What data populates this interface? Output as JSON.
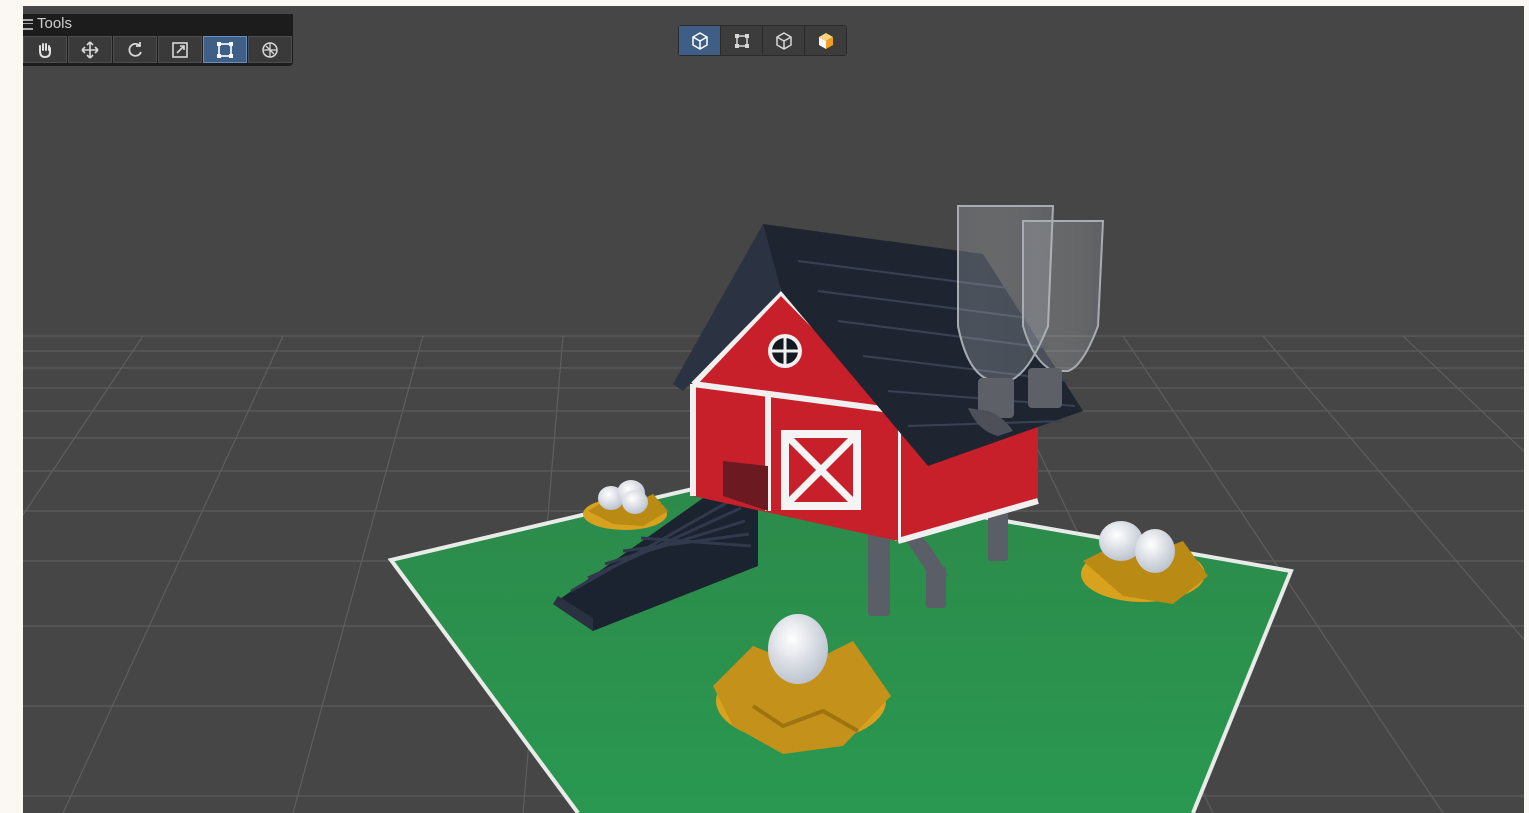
{
  "tools_panel": {
    "title": "Tools",
    "tools": [
      {
        "name": "hand-tool",
        "icon": "hand-icon",
        "active": false
      },
      {
        "name": "move-tool",
        "icon": "move-arrows-icon",
        "active": false
      },
      {
        "name": "rotate-tool",
        "icon": "rotate-icon",
        "active": false
      },
      {
        "name": "scale-tool",
        "icon": "scale-icon",
        "active": false
      },
      {
        "name": "rect-tool",
        "icon": "rect-transform-icon",
        "active": true
      },
      {
        "name": "transform-tool",
        "icon": "transform-gizmo-icon",
        "active": false
      }
    ]
  },
  "view_toolbar": {
    "buttons": [
      {
        "name": "wireframe-cube",
        "icon": "cube-outline-icon",
        "active": true
      },
      {
        "name": "rect-select",
        "icon": "rect-frame-icon",
        "active": false
      },
      {
        "name": "shaded-cube",
        "icon": "cube-outline-icon",
        "active": false
      },
      {
        "name": "lit-cube",
        "icon": "cube-orange-icon",
        "active": false
      }
    ]
  },
  "colors": {
    "viewport_bg": "#464646",
    "grass": "#2e8b4c",
    "barn_red": "#c8202a",
    "roof": "#1f2530",
    "nest_gold": "#d8a21e",
    "active_button": "#3f5f87"
  }
}
